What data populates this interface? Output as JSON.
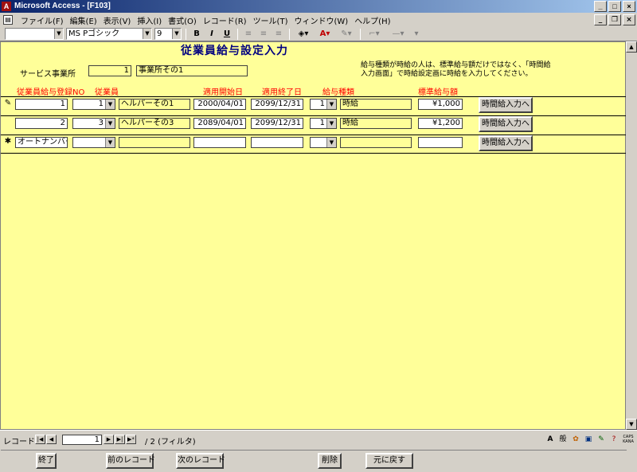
{
  "window": {
    "title": "Microsoft Access - [F103]"
  },
  "menu": {
    "items": [
      "ファイル(F)",
      "編集(E)",
      "表示(V)",
      "挿入(I)",
      "書式(O)",
      "レコード(R)",
      "ツール(T)",
      "ウィンドウ(W)",
      "ヘルプ(H)"
    ]
  },
  "toolbar": {
    "font_name": "MS Pゴシック",
    "font_size": "9",
    "bold": "B",
    "italic": "I",
    "underline": "U"
  },
  "form": {
    "title": "従業員給与設定入力",
    "service_label": "サービス事業所",
    "service_code": "1",
    "service_name": "事業所その1",
    "note": "給与種類が時給の人は、標準給与額だけではなく、「時間給入力画面」で時給設定画に時給を入力してください。",
    "headers": {
      "reg_no": "従業員給与登録NO",
      "employee": "従業員",
      "start_date": "適用開始日",
      "end_date": "適用終了日",
      "pay_type": "給与種類",
      "std_pay": "標準給与額"
    },
    "rows": [
      {
        "selector": "✎",
        "reg_no": "1",
        "emp_code": "1",
        "emp_name": "ヘルパーその1",
        "start_date": "2000/04/01",
        "end_date": "2099/12/31",
        "pay_code": "1",
        "pay_name": "時給",
        "std_pay": "¥1,000",
        "button": "時間給入力へ"
      },
      {
        "selector": "",
        "reg_no": "2",
        "emp_code": "3",
        "emp_name": "ヘルパーその3",
        "start_date": "2089/04/01",
        "end_date": "2099/12/31",
        "pay_code": "1",
        "pay_name": "時給",
        "std_pay": "¥1,200",
        "button": "時間給入力へ"
      },
      {
        "selector": "✱",
        "reg_no": "オートナンバー",
        "emp_code": "",
        "emp_name": "",
        "start_date": "",
        "end_date": "",
        "pay_code": "",
        "pay_name": "",
        "std_pay": "",
        "button": "時間給入力へ"
      }
    ],
    "footer": {
      "exit": "終了",
      "prev": "前のレコード",
      "next": "次のレコード",
      "delete": "削除",
      "undo": "元に戻す"
    }
  },
  "navigation": {
    "label": "レコード:",
    "current": "1",
    "total": "/ 2 (フィルタ)"
  },
  "tray": {
    "ime": "般",
    "caps": "CAPS KANA"
  }
}
